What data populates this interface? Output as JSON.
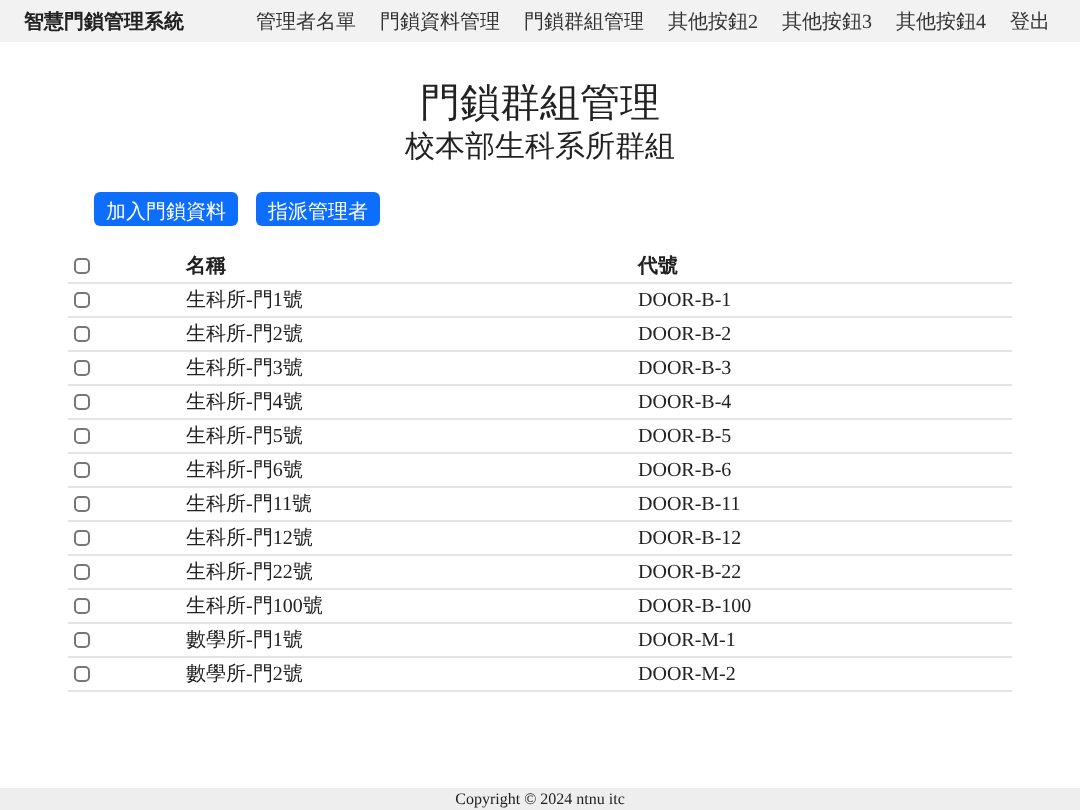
{
  "navbar": {
    "brand": "智慧門鎖管理系統",
    "items": [
      "管理者名單",
      "門鎖資料管理",
      "門鎖群組管理",
      "其他按鈕2",
      "其他按鈕3",
      "其他按鈕4",
      "登出"
    ]
  },
  "title": "門鎖群組管理",
  "subtitle": "校本部生科系所群組",
  "buttons": [
    "加入門鎖資料",
    "指派管理者"
  ],
  "table": {
    "select_all": {
      "checked": false
    },
    "columns": [
      "名稱",
      "代號"
    ],
    "rows": [
      {
        "checked": false,
        "name": "生科所-門1號",
        "code": "DOOR-B-1"
      },
      {
        "checked": false,
        "name": "生科所-門2號",
        "code": "DOOR-B-2"
      },
      {
        "checked": false,
        "name": "生科所-門3號",
        "code": "DOOR-B-3"
      },
      {
        "checked": false,
        "name": "生科所-門4號",
        "code": "DOOR-B-4"
      },
      {
        "checked": false,
        "name": "生科所-門5號",
        "code": "DOOR-B-5"
      },
      {
        "checked": false,
        "name": "生科所-門6號",
        "code": "DOOR-B-6"
      },
      {
        "checked": false,
        "name": "生科所-門11號",
        "code": "DOOR-B-11"
      },
      {
        "checked": false,
        "name": "生科所-門12號",
        "code": "DOOR-B-12"
      },
      {
        "checked": false,
        "name": "生科所-門22號",
        "code": "DOOR-B-22"
      },
      {
        "checked": false,
        "name": "生科所-門100號",
        "code": "DOOR-B-100"
      },
      {
        "checked": false,
        "name": "數學所-門1號",
        "code": "DOOR-M-1"
      },
      {
        "checked": false,
        "name": "數學所-門2號",
        "code": "DOOR-M-2"
      }
    ]
  },
  "footer": "Copyright © 2024 ntnu itc"
}
